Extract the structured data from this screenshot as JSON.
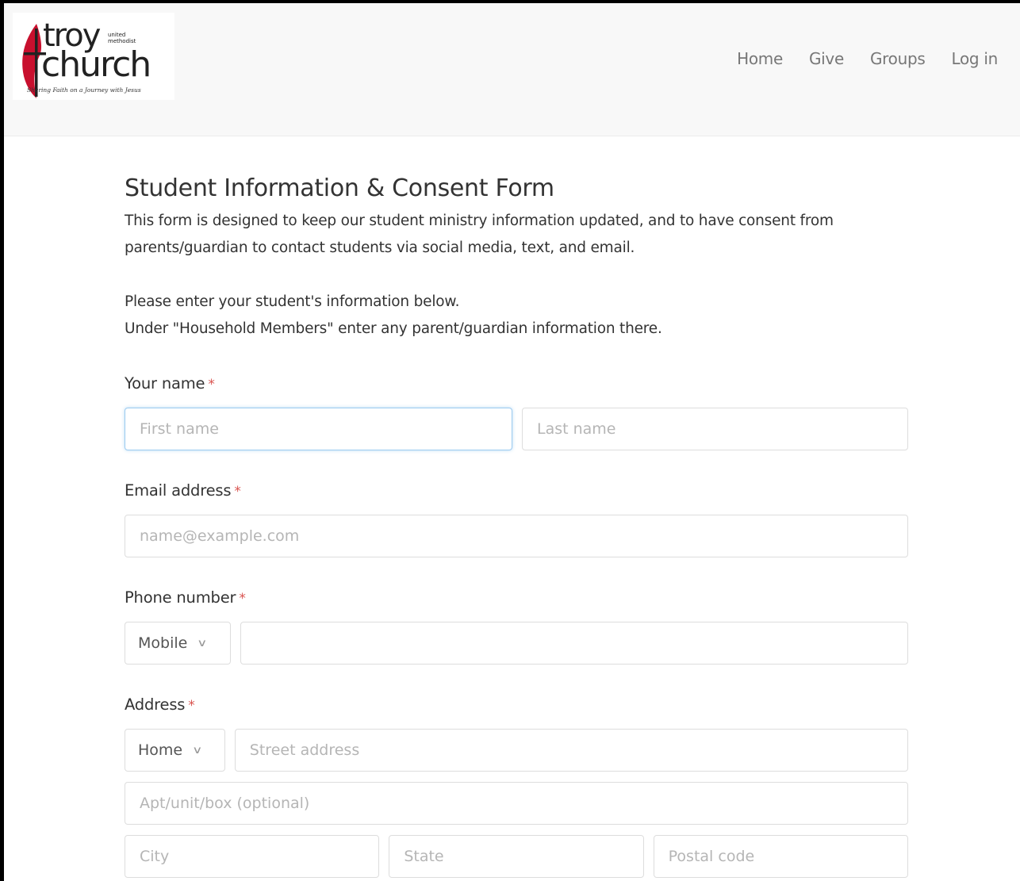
{
  "logo": {
    "line1": "troy",
    "line1_small": "united methodist",
    "line2": "church",
    "tagline": "Sharing Faith on a Journey with Jesus",
    "accent_color": "#c8102e"
  },
  "nav": {
    "items": [
      {
        "label": "Home"
      },
      {
        "label": "Give"
      },
      {
        "label": "Groups"
      },
      {
        "label": "Log in"
      }
    ]
  },
  "form": {
    "title": "Student Information & Consent Form",
    "intro": "This form is designed to keep our student ministry information updated, and to have consent from parents/guardian to contact students via social media, text, and email.",
    "instructions_line1": "Please enter your student's information below.",
    "instructions_line2": "Under \"Household Members\" enter any parent/guardian information there.",
    "required_marker": "*",
    "name": {
      "label": "Your name",
      "first_placeholder": "First name",
      "last_placeholder": "Last name"
    },
    "email": {
      "label": "Email address",
      "placeholder": "name@example.com"
    },
    "phone": {
      "label": "Phone number",
      "type_selected": "Mobile",
      "value": ""
    },
    "address": {
      "label": "Address",
      "type_selected": "Home",
      "street_placeholder": "Street address",
      "apt_placeholder": "Apt/unit/box (optional)",
      "city_placeholder": "City",
      "state_placeholder": "State",
      "postal_placeholder": "Postal code"
    }
  },
  "colors": {
    "required": "#d9534f",
    "focus_border": "#9ccbf0",
    "nav_text": "#777777",
    "navbar_bg": "#f8f8f8"
  }
}
